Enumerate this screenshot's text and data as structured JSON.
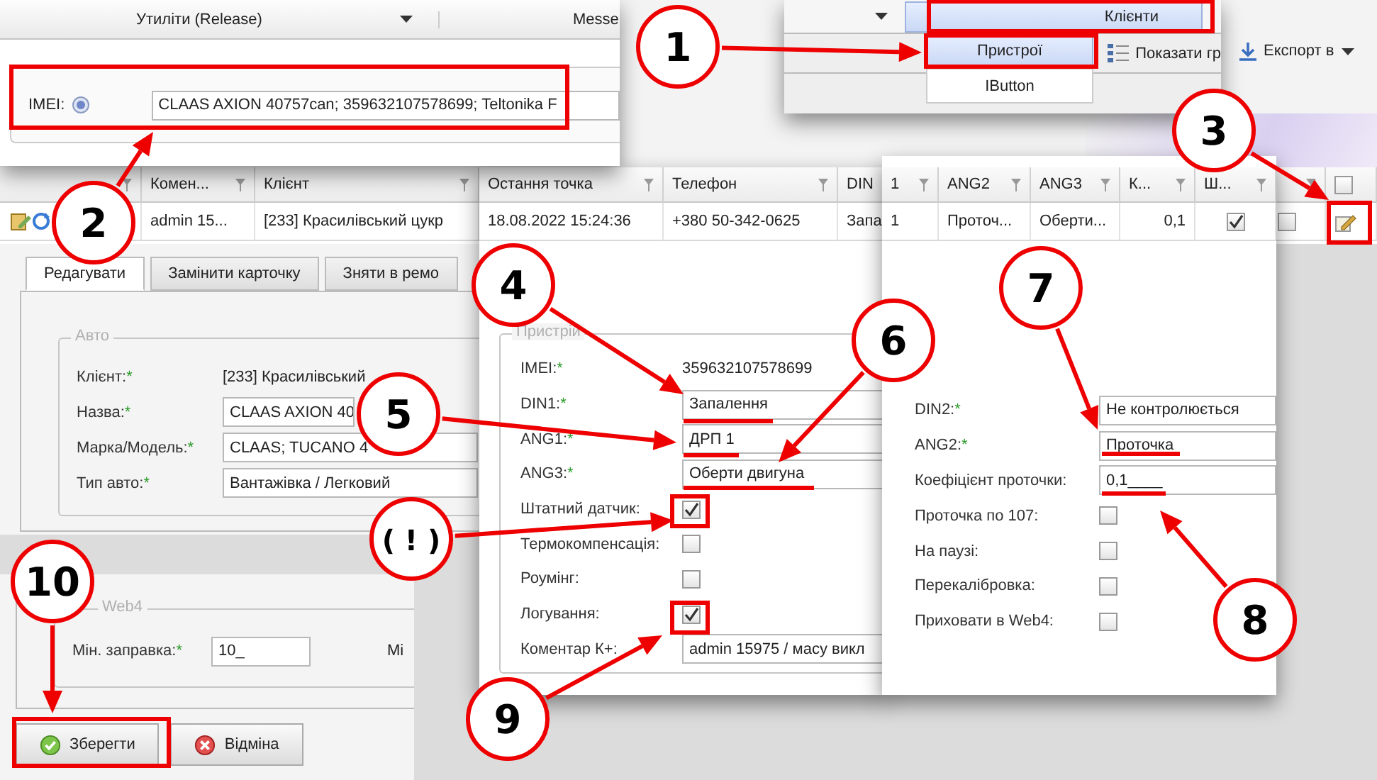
{
  "utilities_panel": {
    "title": "Утиліти (Release)",
    "next_title": "Messe",
    "imei_label": "IMEI:",
    "imei_value": "CLAAS AXION 40757can; 359632107578699; Teltonika F"
  },
  "menu_panel": {
    "header": "Клієнти",
    "items": [
      {
        "label": "Пристрої",
        "selected": true
      },
      {
        "label": "IButton",
        "selected": false
      }
    ],
    "toolbar": [
      "Показати гр"
    ]
  },
  "top_toolbar": {
    "export": "Експорт в"
  },
  "grid": {
    "columns": [
      "Комен...",
      "Клієнт"
    ],
    "row": [
      "admin 15...",
      "[233] Красилівський цукр"
    ],
    "header_checkbox": {
      "checked": false
    },
    "row_checkbox": {
      "checked": false
    }
  },
  "device_grid": {
    "columns": [
      "Остання точка",
      "Телефон",
      "DIN"
    ],
    "row": [
      "18.08.2022 15:24:36",
      "+380 50-342-0625",
      "Запа"
    ]
  },
  "sensor_grid": {
    "columns": [
      "1",
      "ANG2",
      "ANG3",
      "К...",
      "Ш..."
    ],
    "row": [
      {
        "kind": "text",
        "text": "1"
      },
      {
        "kind": "text",
        "text": "Проточ..."
      },
      {
        "kind": "text",
        "text": "Оберти..."
      },
      {
        "kind": "number",
        "text": "0,1"
      },
      {
        "kind": "check",
        "checked": true
      }
    ]
  },
  "tabs": [
    {
      "label": "Редагувати",
      "selected": true
    },
    {
      "label": "Замінити карточку",
      "selected": false
    },
    {
      "label": "Зняти в ремо",
      "selected": false
    }
  ],
  "auto_fieldset": {
    "legend": "Авто",
    "fields": [
      {
        "label": "Клієнт:",
        "mark": "*",
        "kind": "text",
        "value": "[233] Красилівський"
      },
      {
        "label": "Назва:",
        "mark": "*",
        "kind": "input",
        "value": "CLAAS AXION 40"
      },
      {
        "label": "Марка/Модель:",
        "mark": "*",
        "kind": "input",
        "value": "CLAAS; TUCANO 4"
      },
      {
        "label": "Тип авто:",
        "mark": "*",
        "kind": "input",
        "value": "Вантажівка / Легковий"
      }
    ]
  },
  "device_fieldset": {
    "legend": "Пристрій",
    "fields": [
      {
        "label": "IMEI:",
        "mark": "*",
        "kind": "text",
        "value": "359632107578699"
      },
      {
        "label": "DIN1:",
        "mark": "*",
        "kind": "input",
        "value": "Запалення"
      },
      {
        "label": "ANG1:",
        "mark": "*",
        "kind": "input",
        "value": "ДРП 1"
      },
      {
        "label": "ANG3:",
        "mark": "*",
        "kind": "input",
        "value": "Оберти двигуна"
      },
      {
        "label": "Штатний датчик:",
        "kind": "check",
        "checked": true
      },
      {
        "label": "Термокомпенсація:",
        "kind": "check",
        "checked": false
      },
      {
        "label": "Роумінг:",
        "kind": "check",
        "checked": false
      },
      {
        "label": "Логування:",
        "kind": "check",
        "checked": true
      },
      {
        "label": "Коментар К+:",
        "kind": "input",
        "value": "admin 15975 / масу викл"
      }
    ]
  },
  "sensor_fields": [
    {
      "label": "DIN2:",
      "mark": "*",
      "kind": "input",
      "value": "Не контролюється"
    },
    {
      "label": "ANG2:",
      "mark": "*",
      "kind": "input",
      "value": "Проточка"
    },
    {
      "label": "Коефіцієнт проточки:",
      "kind": "input",
      "value": "0,1____"
    },
    {
      "label": "Проточка по 107:",
      "kind": "check",
      "checked": false
    },
    {
      "label": "На паузі:",
      "kind": "check",
      "checked": false
    },
    {
      "label": "Перекалібровка:",
      "kind": "check",
      "checked": false
    },
    {
      "label": "Приховати в Web4:",
      "kind": "check",
      "checked": false
    }
  ],
  "web4": {
    "legend": "Web4",
    "fields": [
      {
        "label": "Мін. заправка:",
        "mark": "*",
        "kind": "input",
        "value": "10_"
      }
    ],
    "cut_label": "Мі"
  },
  "buttons": [
    "Зберегти",
    "Відміна"
  ],
  "callouts": [
    "1",
    "2",
    "3",
    "4",
    "5",
    "6",
    "7",
    "8",
    "9",
    "10",
    "( ! )"
  ]
}
